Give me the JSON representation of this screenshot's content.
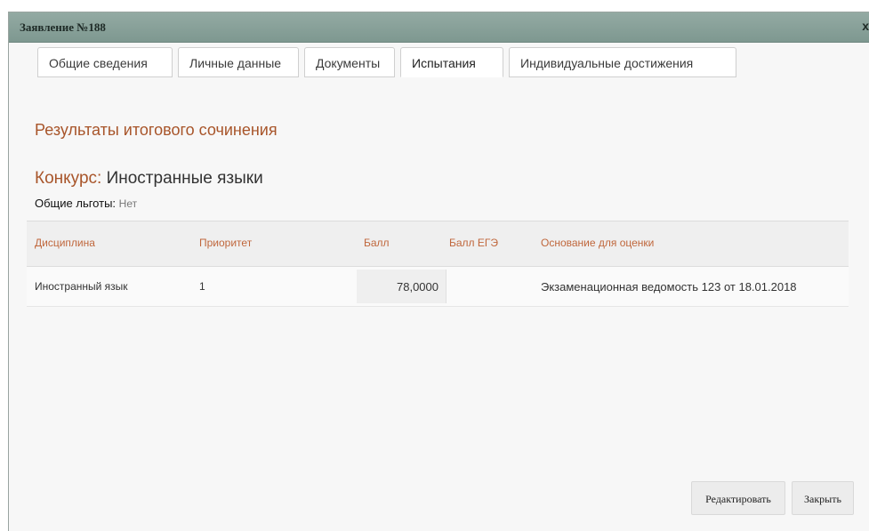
{
  "dialog": {
    "title": "Заявление №188",
    "close_glyph": "x"
  },
  "tabs": [
    {
      "label": "Общие сведения"
    },
    {
      "label": "Личные данные"
    },
    {
      "label": "Документы"
    },
    {
      "label": "Испытания"
    },
    {
      "label": "Индивидуальные достижения"
    }
  ],
  "active_tab": "Испытания",
  "section_title": "Результаты итогового сочинения",
  "contest": {
    "label": "Конкурс:",
    "value": "Иностранные языки"
  },
  "benefits": {
    "label": "Общие льготы:",
    "value": "Нет"
  },
  "table": {
    "headers": [
      "Дисциплина",
      "Приоритет",
      "Балл",
      "Балл ЕГЭ",
      "Основание для оценки"
    ],
    "rows": [
      {
        "discipline": "Иностранный язык",
        "priority": "1",
        "score": "78,0000",
        "ege_score": "",
        "basis": "Экзаменационная ведомость 123 от 18.01.2018"
      }
    ]
  },
  "buttons": {
    "edit": "Редактировать",
    "close": "Закрыть"
  },
  "colors": {
    "accent": "#a8552a",
    "titlebar": "#7e9890",
    "header_text": "#c0673c"
  }
}
